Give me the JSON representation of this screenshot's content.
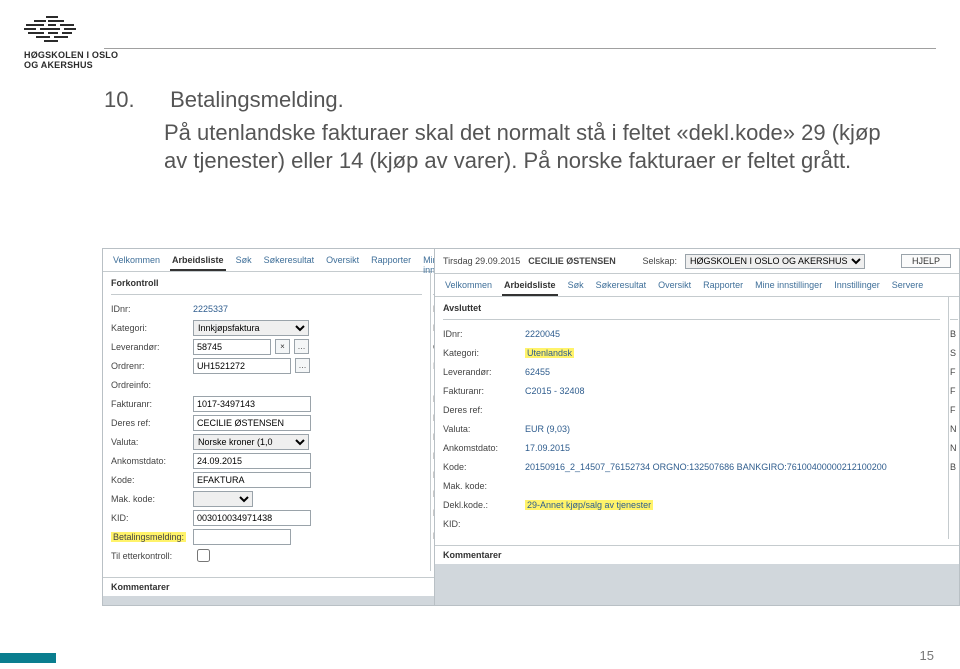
{
  "logo": {
    "line1": "HØGSKOLEN I OSLO",
    "line2": "OG AKERSHUS"
  },
  "text": {
    "num": "10.",
    "title": "Betalingsmelding.",
    "para": "På utenlandske fakturaer skal det normalt stå i feltet «dekl.kode» 29 (kjøp av tjenester) eller 14 (kjøp av varer). På norske fakturaer er feltet grått."
  },
  "left": {
    "tabs": [
      "Velkommen",
      "Arbeidsliste",
      "Søk",
      "Søkeresultat",
      "Oversikt",
      "Rapporter",
      "Mine innstill"
    ],
    "active_tab": 1,
    "section": "Forkontroll",
    "fields": {
      "idnr_label": "IDnr:",
      "idnr": "2225337",
      "kategori_label": "Kategori:",
      "kategori": "Innkjøpsfaktura",
      "leverandor_label": "Leverandør:",
      "leverandor": "58745",
      "ordrenr_label": "Ordrenr:",
      "ordrenr": "UH1521272",
      "ordreinfo_label": "Ordreinfo:",
      "fakturanr_label": "Fakturanr:",
      "fakturanr": "1017-3497143",
      "deresref_label": "Deres ref:",
      "deresref": "CECILIE ØSTENSEN",
      "valuta_label": "Valuta:",
      "valuta": "Norske kroner (1,0",
      "ankomst_label": "Ankomstdato:",
      "ankomst": "24.09.2015",
      "kode_label": "Kode:",
      "kode": "EFAKTURA",
      "makkode_label": "Mak. kode:",
      "kid_label": "KID:",
      "kid": "003010034971438",
      "betalings_label": "Betalingsmelding:",
      "tiletter_label": "Til etterkontroll:"
    },
    "rightcol": [
      "Bila",
      "ELK",
      "Ord",
      "Innk",
      "Fakt",
      "Forf",
      "Brut",
      "Mva",
      "Nett",
      "Belø",
      "Dek"
    ],
    "bottom_hint": "Kom",
    "comments_label": "Kommentarer"
  },
  "right": {
    "topbar": {
      "date": "Tirsdag 29.09.2015",
      "user": "CECILIE ØSTENSEN",
      "selskap_label": "Selskap:",
      "selskap": "HØGSKOLEN I OSLO OG AKERSHUS (P)",
      "help": "HJELP"
    },
    "tabs": [
      "Velkommen",
      "Arbeidsliste",
      "Søk",
      "Søkeresultat",
      "Oversikt",
      "Rapporter",
      "Mine innstillinger",
      "Innstillinger",
      "Servere"
    ],
    "active_tab": 1,
    "section": "Avsluttet",
    "fields": {
      "idnr_label": "IDnr:",
      "idnr": "2220045",
      "kategori_label": "Kategori:",
      "kategori": "Utenlandsk",
      "leverandor_label": "Leverandør:",
      "leverandor": "62455",
      "fakturanr_label": "Fakturanr:",
      "fakturanr": "C2015 - 32408",
      "deresref_label": "Deres ref:",
      "valuta_label": "Valuta:",
      "valuta": "EUR (9,03)",
      "ankomst_label": "Ankomstdato:",
      "ankomst": "17.09.2015",
      "kode_label": "Kode:",
      "kode": "20150916_2_14507_76152734 ORGNO:132507686 BANKGIRO:76100400000212100200",
      "makkode_label": "Mak. kode:",
      "deklkode_label": "Dekl.kode.:",
      "deklkode": "29-Annet kjøp/salg av tjenester",
      "kid_label": "KID:"
    },
    "initials": [
      "B",
      "S",
      "F",
      "F",
      "F",
      "N",
      "N",
      "B"
    ],
    "comments_label": "Kommentarer"
  },
  "page_number": "15"
}
